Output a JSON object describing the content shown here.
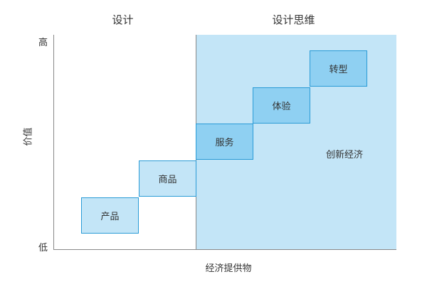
{
  "headers": {
    "left": "设计",
    "right": "设计思维"
  },
  "axes": {
    "y_label": "价值",
    "y_high": "高",
    "y_low": "低",
    "x_label": "经济提供物"
  },
  "steps": [
    {
      "label": "产品",
      "level": 1,
      "style": "light"
    },
    {
      "label": "商品",
      "level": 2,
      "style": "light"
    },
    {
      "label": "服务",
      "level": 3,
      "style": "dark"
    },
    {
      "label": "体验",
      "level": 4,
      "style": "dark"
    },
    {
      "label": "转型",
      "level": 5,
      "style": "dark"
    }
  ],
  "region_label": "创新经济",
  "colors": {
    "region_fill": "#c3e5f7",
    "box_border": "#2a9bd6",
    "box_dark_fill": "#8fd0f2",
    "axis": "#888888"
  }
}
